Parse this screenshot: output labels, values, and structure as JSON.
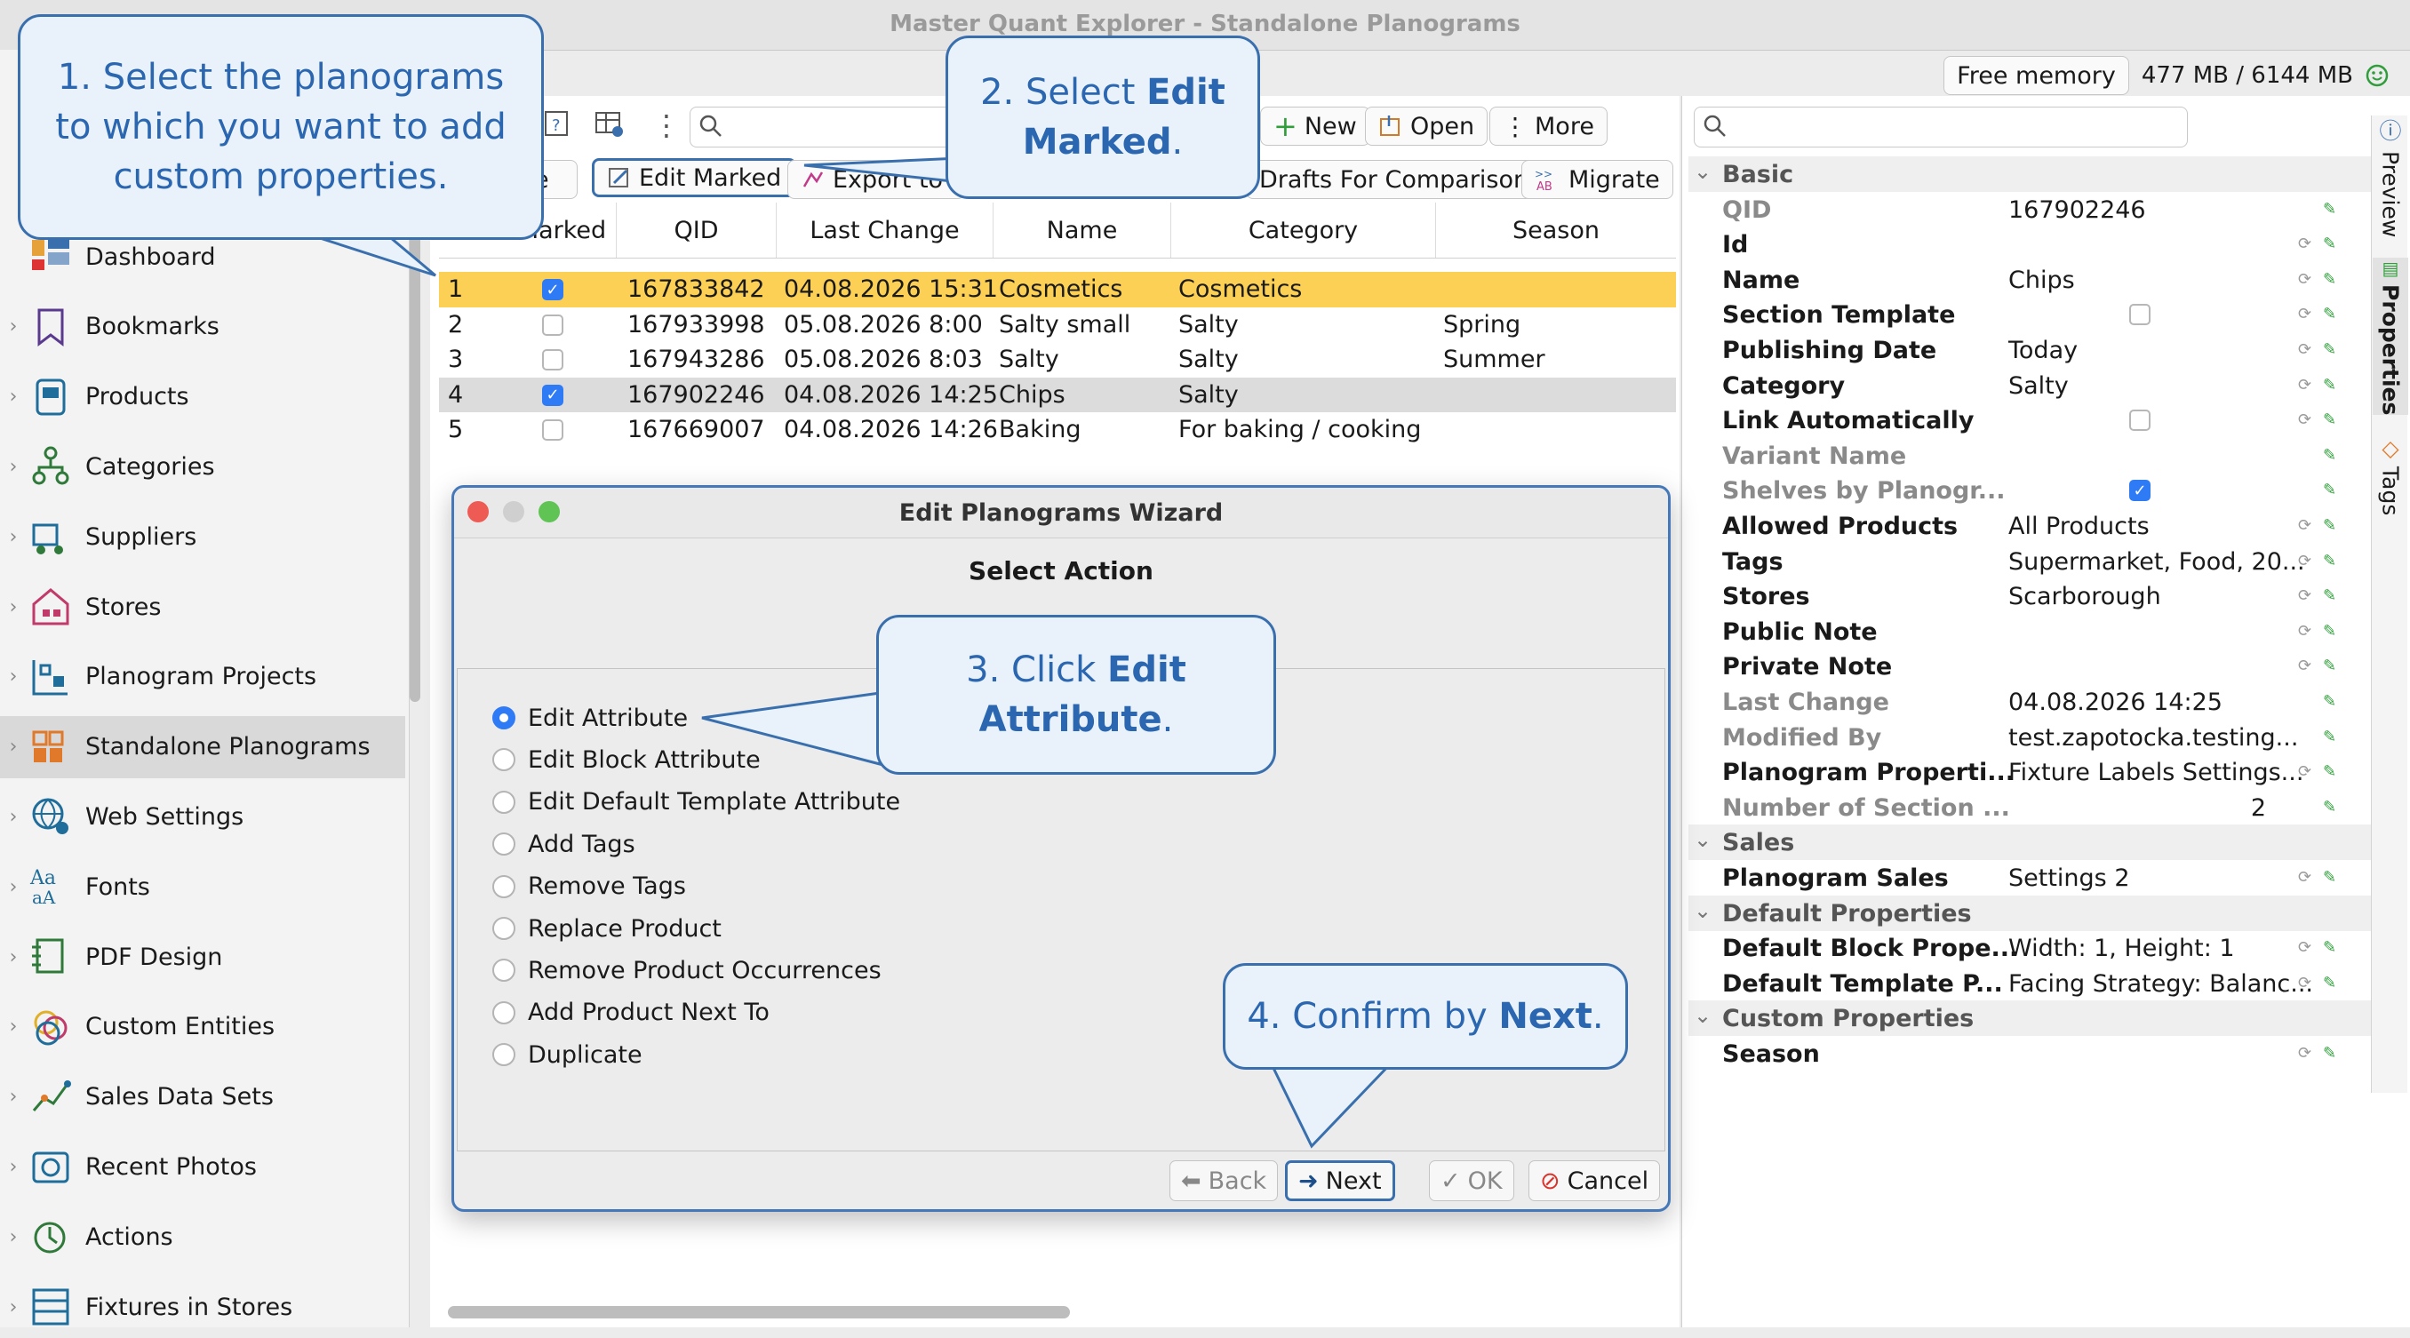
{
  "app": {
    "title": "Master Quant Explorer - Standalone Planograms"
  },
  "status": {
    "memory_label": "Free memory",
    "memory_value": "477 MB / 6144 MB"
  },
  "toolbar": {
    "new": "New",
    "open": "Open",
    "more": "More",
    "save_partial": "ve",
    "edit_marked": "Edit Marked",
    "export": "Export to",
    "drafts": "Drafts For Comparison",
    "migrate": "Migrate"
  },
  "sidebar": {
    "items": [
      {
        "label": "Dashboard",
        "icon": "dashboard-icon"
      },
      {
        "label": "Bookmarks",
        "icon": "bookmark-icon"
      },
      {
        "label": "Products",
        "icon": "product-icon"
      },
      {
        "label": "Categories",
        "icon": "categories-icon"
      },
      {
        "label": "Suppliers",
        "icon": "supplier-icon"
      },
      {
        "label": "Stores",
        "icon": "store-icon"
      },
      {
        "label": "Planogram Projects",
        "icon": "planogram-projects-icon"
      },
      {
        "label": "Standalone Planograms",
        "icon": "standalone-planograms-icon",
        "selected": true
      },
      {
        "label": "Web Settings",
        "icon": "web-settings-icon"
      },
      {
        "label": "Fonts",
        "icon": "fonts-icon"
      },
      {
        "label": "PDF Design",
        "icon": "pdf-design-icon"
      },
      {
        "label": "Custom Entities",
        "icon": "custom-entities-icon"
      },
      {
        "label": "Sales Data Sets",
        "icon": "sales-data-icon"
      },
      {
        "label": "Recent Photos",
        "icon": "photos-icon"
      },
      {
        "label": "Actions",
        "icon": "actions-icon"
      },
      {
        "label": "Fixtures in Stores",
        "icon": "fixtures-icon"
      }
    ]
  },
  "table": {
    "headers": [
      "Marked",
      "QID",
      "Last Change",
      "Name",
      "Category",
      "Season"
    ],
    "rows": [
      {
        "n": "1",
        "marked": true,
        "qid": "167833842",
        "change": "04.08.2026 15:31",
        "name": "Cosmetics",
        "category": "Cosmetics",
        "season": ""
      },
      {
        "n": "2",
        "marked": false,
        "qid": "167933998",
        "change": "05.08.2026 8:00",
        "name": "Salty small",
        "category": "Salty",
        "season": "Spring"
      },
      {
        "n": "3",
        "marked": false,
        "qid": "167943286",
        "change": "05.08.2026 8:03",
        "name": "Salty",
        "category": "Salty",
        "season": "Summer"
      },
      {
        "n": "4",
        "marked": true,
        "qid": "167902246",
        "change": "04.08.2026 14:25",
        "name": "Chips",
        "category": "Salty",
        "season": ""
      },
      {
        "n": "5",
        "marked": false,
        "qid": "167669007",
        "change": "04.08.2026 14:26",
        "name": "Baking",
        "category": "For baking / cooking",
        "season": ""
      }
    ]
  },
  "properties": {
    "rows": [
      {
        "kind": "section",
        "label": "Basic"
      },
      {
        "label": "QID",
        "value": "167902246",
        "dim": true
      },
      {
        "label": "Id",
        "value": ""
      },
      {
        "label": "Name",
        "value": "Chips"
      },
      {
        "label": "Section Template",
        "value": "",
        "checkbox": false
      },
      {
        "label": "Publishing Date",
        "value": "Today"
      },
      {
        "label": "Category",
        "value": "Salty"
      },
      {
        "label": "Link Automatically",
        "value": "",
        "checkbox": false
      },
      {
        "label": "Variant Name",
        "value": "",
        "dim": true
      },
      {
        "label": "Shelves by Planogr...",
        "value": "",
        "dim": true,
        "checkbox": true
      },
      {
        "label": "Allowed Products",
        "value": "All Products"
      },
      {
        "label": "Tags",
        "value": "Supermarket, Food, 20..."
      },
      {
        "label": "Stores",
        "value": "Scarborough"
      },
      {
        "label": "Public Note",
        "value": ""
      },
      {
        "label": "Private Note",
        "value": ""
      },
      {
        "label": "Last Change",
        "value": "04.08.2026 14:25",
        "dim": true
      },
      {
        "label": "Modified By",
        "value": "test.zapotocka.testing...",
        "dim": true
      },
      {
        "label": "Planogram Properti...",
        "value": "Fixture Labels Settings..."
      },
      {
        "label": "Number of Section ...",
        "value": "2",
        "dim": true,
        "right": true
      },
      {
        "kind": "section",
        "label": "Sales"
      },
      {
        "label": "Planogram Sales",
        "value": "Settings 2"
      },
      {
        "kind": "section",
        "label": "Default Properties"
      },
      {
        "label": "Default Block Prope...",
        "value": "Width: 1, Height: 1"
      },
      {
        "label": "Default Template P...",
        "value": "Facing Strategy: Balanc..."
      },
      {
        "kind": "section",
        "label": "Custom Properties"
      },
      {
        "label": "Season",
        "value": ""
      }
    ]
  },
  "side_tabs": {
    "preview": "Preview",
    "properties": "Properties",
    "tags": "Tags"
  },
  "dialog": {
    "title": "Edit Planograms Wizard",
    "heading": "Select Action",
    "options": [
      {
        "label": "Edit Attribute",
        "selected": true
      },
      {
        "label": "Edit Block Attribute"
      },
      {
        "label": "Edit Default Template Attribute"
      },
      {
        "label": "Add Tags"
      },
      {
        "label": "Remove Tags"
      },
      {
        "label": "Replace Product"
      },
      {
        "label": "Remove Product Occurrences"
      },
      {
        "label": "Add Product Next To"
      },
      {
        "label": "Duplicate"
      }
    ],
    "buttons": {
      "back": "Back",
      "next": "Next",
      "ok": "OK",
      "cancel": "Cancel"
    }
  },
  "callouts": {
    "c1": "1. Select the planograms to which you want to add custom properties.",
    "c2_pre": "2. Select ",
    "c2_bold": "Edit Marked",
    "c2_post": ".",
    "c3_pre": "3. Click ",
    "c3_bold": "Edit Attribute",
    "c3_post": ".",
    "c4_pre": "4. Confirm by ",
    "c4_bold": "Next",
    "c4_post": "."
  },
  "colors": {
    "accent": "#2f7bf6",
    "callout_border": "#3a6fae",
    "row_highlight": "#fbd054"
  }
}
